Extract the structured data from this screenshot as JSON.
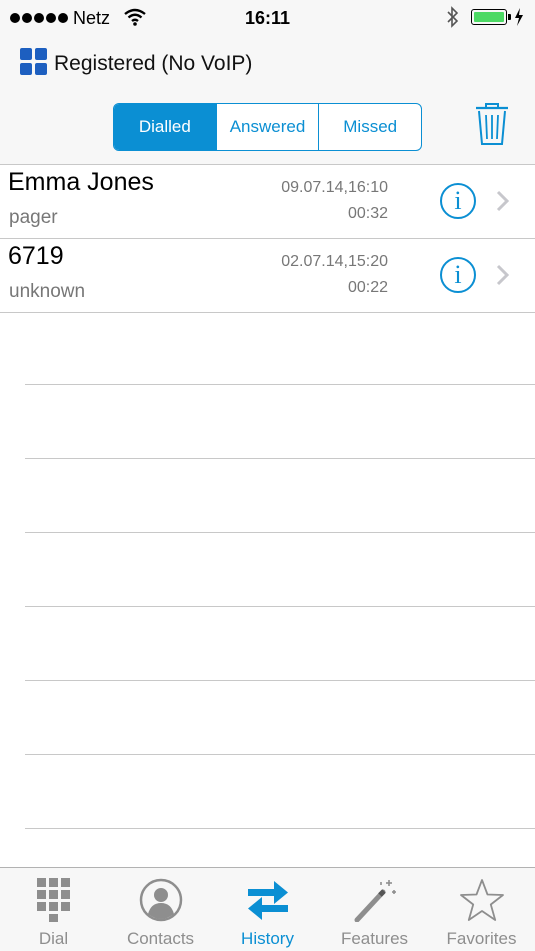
{
  "status_bar": {
    "carrier": "Netz",
    "time": "16:11",
    "signal_bars": 5,
    "battery_level": 1.0
  },
  "header": {
    "registration_status": "Registered (No VoIP)",
    "segments": [
      {
        "label": "Dialled",
        "active": true
      },
      {
        "label": "Answered",
        "active": false
      },
      {
        "label": "Missed",
        "active": false
      }
    ]
  },
  "calls": [
    {
      "name": "Emma Jones",
      "type": "pager",
      "date": "09.07.14,16:10",
      "duration": "00:32"
    },
    {
      "name": "6719",
      "type": "unknown",
      "date": "02.07.14,15:20",
      "duration": "00:22"
    }
  ],
  "tabs": [
    {
      "label": "Dial",
      "icon": "keypad-icon",
      "active": false
    },
    {
      "label": "Contacts",
      "icon": "contact-icon",
      "active": false
    },
    {
      "label": "History",
      "icon": "history-arrows-icon",
      "active": true
    },
    {
      "label": "Features",
      "icon": "magic-wand-icon",
      "active": false
    },
    {
      "label": "Favorites",
      "icon": "star-icon",
      "active": false
    }
  ],
  "colors": {
    "accent": "#0b8fd3",
    "registration_icon": "#1d5fc0",
    "battery": "#4cd964"
  }
}
